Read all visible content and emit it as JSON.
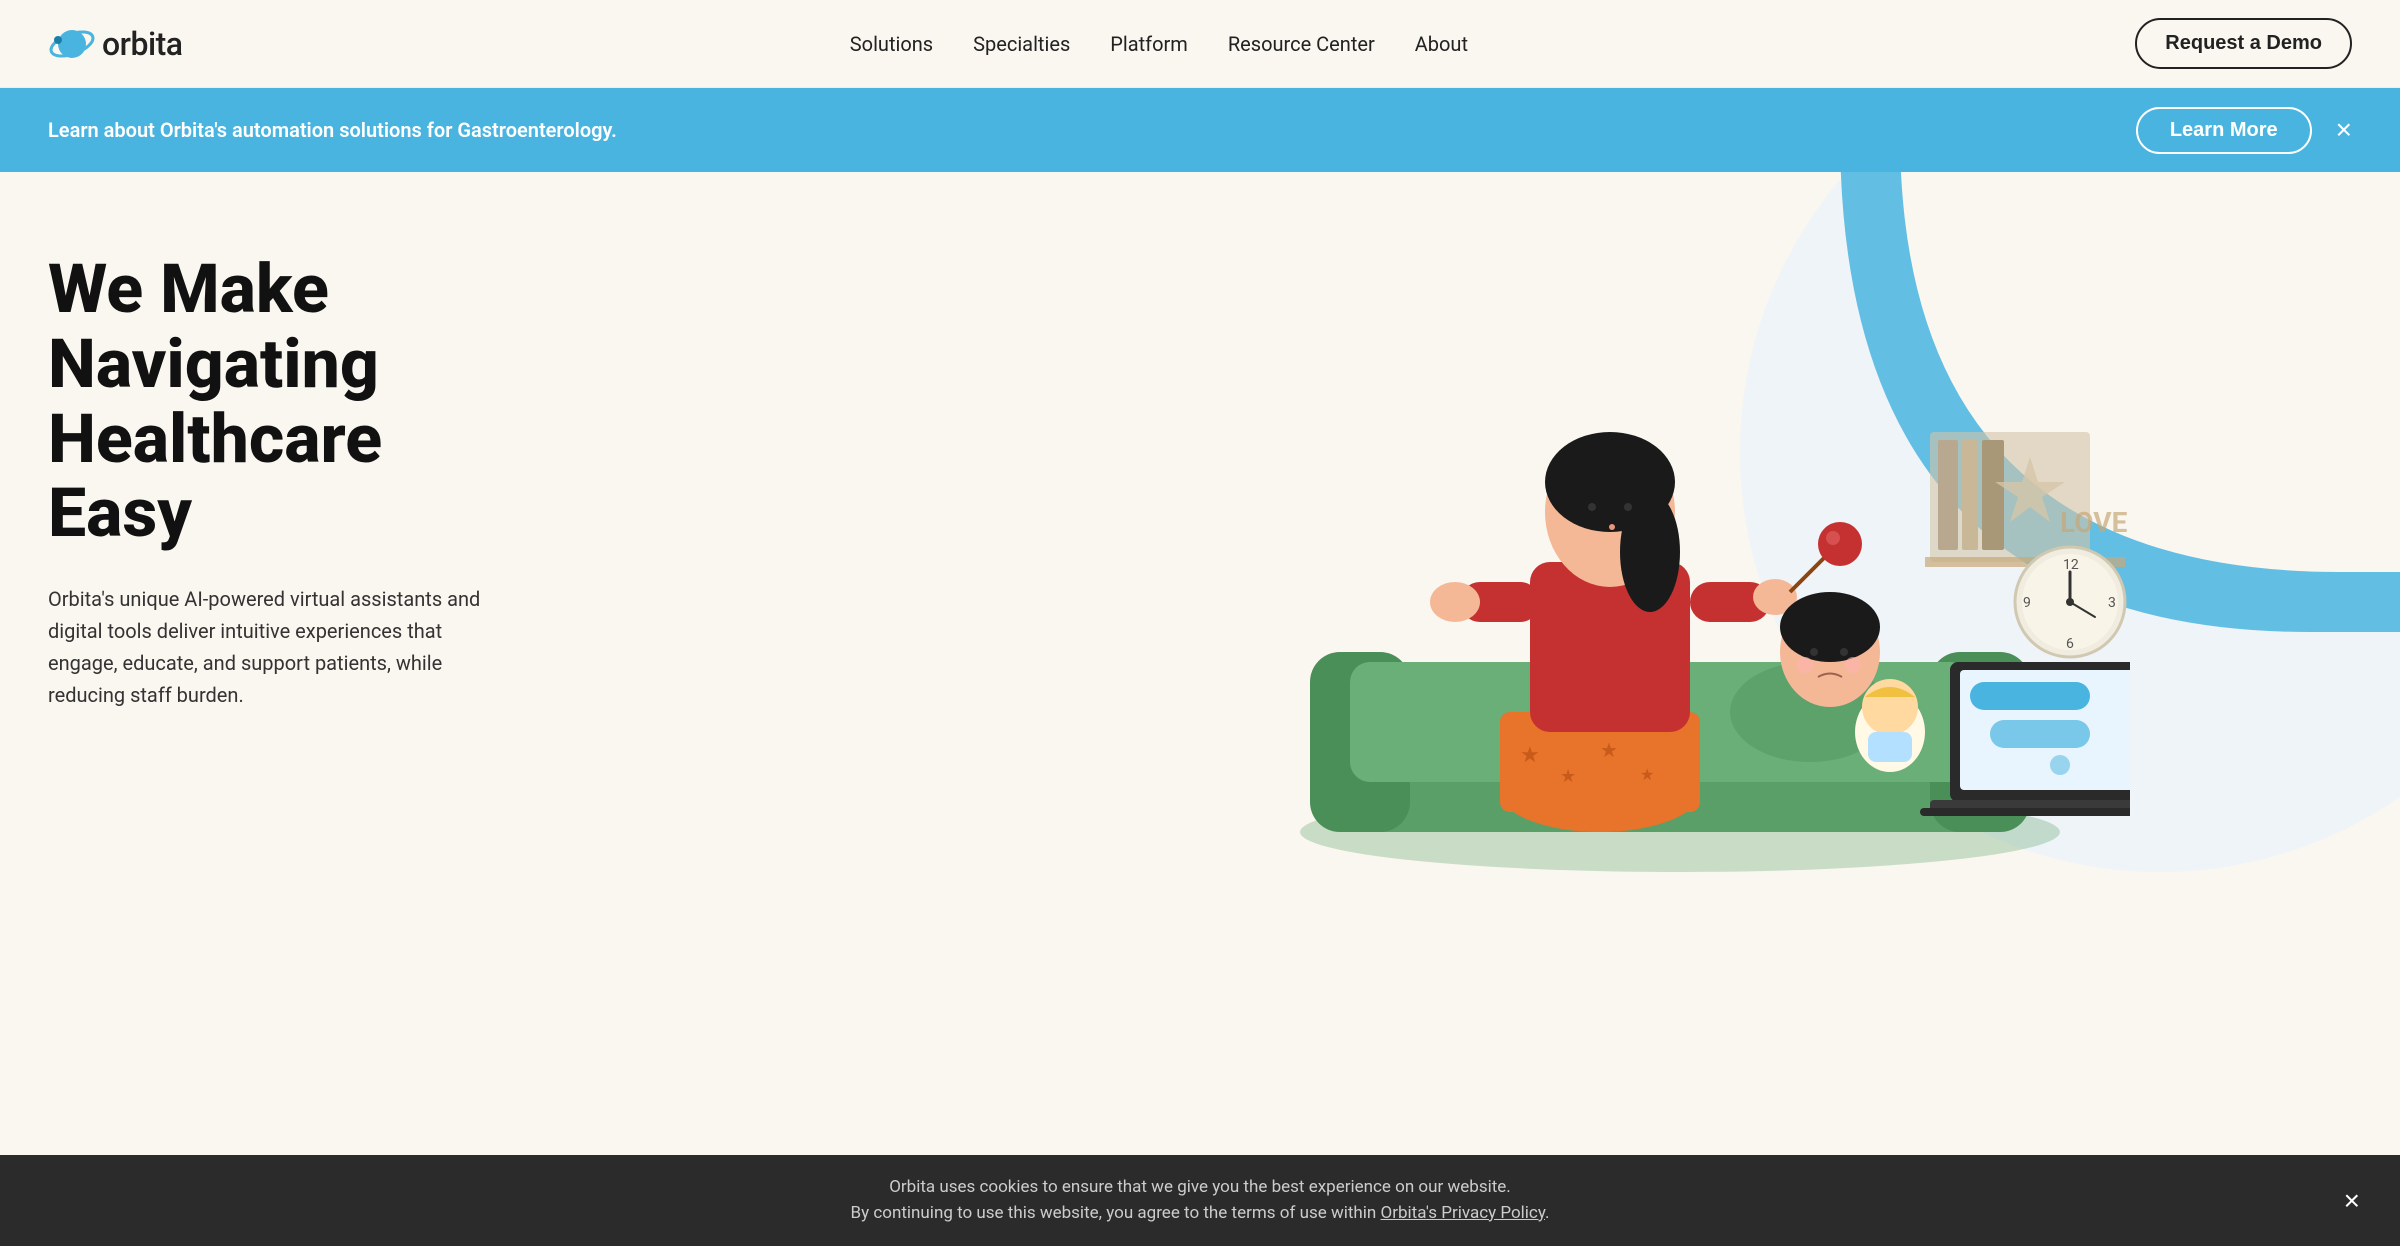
{
  "logo": {
    "alt": "Orbita",
    "text": "orbita"
  },
  "nav": {
    "links": [
      {
        "label": "Solutions",
        "href": "#"
      },
      {
        "label": "Specialties",
        "href": "#"
      },
      {
        "label": "Platform",
        "href": "#"
      },
      {
        "label": "Resource Center",
        "href": "#"
      },
      {
        "label": "About",
        "href": "#"
      }
    ],
    "cta_label": "Request a Demo"
  },
  "banner": {
    "text": "Learn about Orbita's automation solutions for Gastroenterology.",
    "learn_more": "Learn More",
    "close_label": "×"
  },
  "hero": {
    "title": "We Make Navigating Healthcare Easy",
    "subtitle": "Orbita's unique AI-powered virtual assistants and digital tools deliver intuitive experiences that engage, educate, and support patients, while reducing staff burden."
  },
  "cookie": {
    "line1": "Orbita uses cookies to ensure that we give you the best experience on our website.",
    "line2": "By continuing to use this website, you agree to the terms of use within ",
    "link_text": "Orbita's Privacy Policy",
    "close_label": "×"
  },
  "colors": {
    "primary_blue": "#4ab4e0",
    "dark_blue": "#1a7fa8",
    "bg_cream": "#faf6f0",
    "dark": "#111"
  }
}
